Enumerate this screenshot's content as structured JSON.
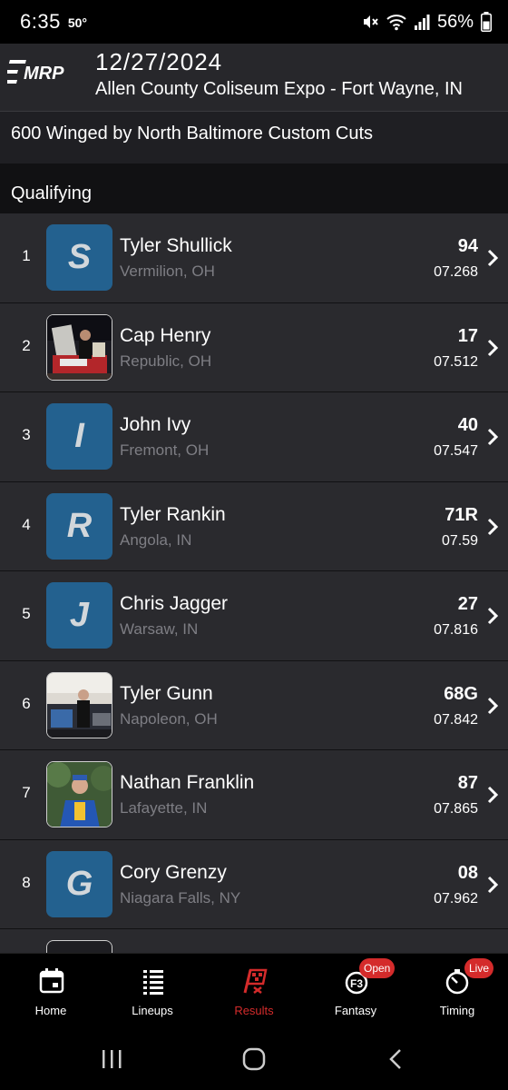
{
  "status_bar": {
    "time": "6:35",
    "temperature": "50°",
    "battery": "56%"
  },
  "header": {
    "logo_alt": "MRP",
    "date": "12/27/2024",
    "venue": "Allen County Coliseum Expo - Fort Wayne, IN"
  },
  "class_name": "600 Winged by North Baltimore Custom Cuts",
  "section": {
    "title": "Qualifying"
  },
  "results": [
    {
      "position": "1",
      "avatar": "S",
      "avatar_type": "letter",
      "name": "Tyler Shullick",
      "hometown": "Vermilion, OH",
      "car": "94",
      "time": "07.268"
    },
    {
      "position": "2",
      "avatar": "",
      "avatar_type": "photo",
      "name": "Cap Henry",
      "hometown": "Republic, OH",
      "car": "17",
      "time": "07.512"
    },
    {
      "position": "3",
      "avatar": "I",
      "avatar_type": "letter",
      "name": "John Ivy",
      "hometown": "Fremont, OH",
      "car": "40",
      "time": "07.547"
    },
    {
      "position": "4",
      "avatar": "R",
      "avatar_type": "letter",
      "name": "Tyler Rankin",
      "hometown": "Angola, IN",
      "car": "71R",
      "time": "07.59"
    },
    {
      "position": "5",
      "avatar": "J",
      "avatar_type": "letter",
      "name": "Chris Jagger",
      "hometown": "Warsaw, IN",
      "car": "27",
      "time": "07.816"
    },
    {
      "position": "6",
      "avatar": "",
      "avatar_type": "photo",
      "name": "Tyler Gunn",
      "hometown": "Napoleon, OH",
      "car": "68G",
      "time": "07.842"
    },
    {
      "position": "7",
      "avatar": "",
      "avatar_type": "photo",
      "name": "Nathan Franklin",
      "hometown": "Lafayette, IN",
      "car": "87",
      "time": "07.865"
    },
    {
      "position": "8",
      "avatar": "G",
      "avatar_type": "letter",
      "name": "Cory Grenzy",
      "hometown": "Niagara Falls, NY",
      "car": "08",
      "time": "07.962"
    }
  ],
  "bottom_nav": [
    {
      "label": "Home",
      "icon": "calendar-icon",
      "active": false,
      "badge": ""
    },
    {
      "label": "Lineups",
      "icon": "lineups-icon",
      "active": false,
      "badge": ""
    },
    {
      "label": "Results",
      "icon": "checkered-flag-icon",
      "active": true,
      "badge": ""
    },
    {
      "label": "Fantasy",
      "icon": "fantasy-icon",
      "active": false,
      "badge": "Open"
    },
    {
      "label": "Timing",
      "icon": "stopwatch-icon",
      "active": false,
      "badge": "Live"
    }
  ],
  "colors": {
    "accent_red": "#d42b2b",
    "avatar_blue": "#23618f",
    "row_bg": "#2a2a2e",
    "header_bg": "#27272b"
  }
}
